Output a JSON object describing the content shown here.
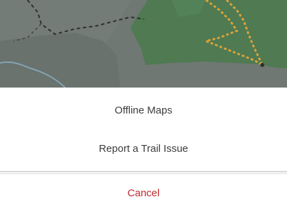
{
  "action_sheet": {
    "items": [
      {
        "label": "Offline Maps"
      },
      {
        "label": "Report a Trail Issue"
      }
    ],
    "cancel_label": "Cancel"
  },
  "colors": {
    "cancel_text": "#c0272d",
    "map_base": "#6b7570",
    "park_area": "#4f7a52",
    "trail_orange": "#d9a33a",
    "water": "#7aa0b8"
  }
}
